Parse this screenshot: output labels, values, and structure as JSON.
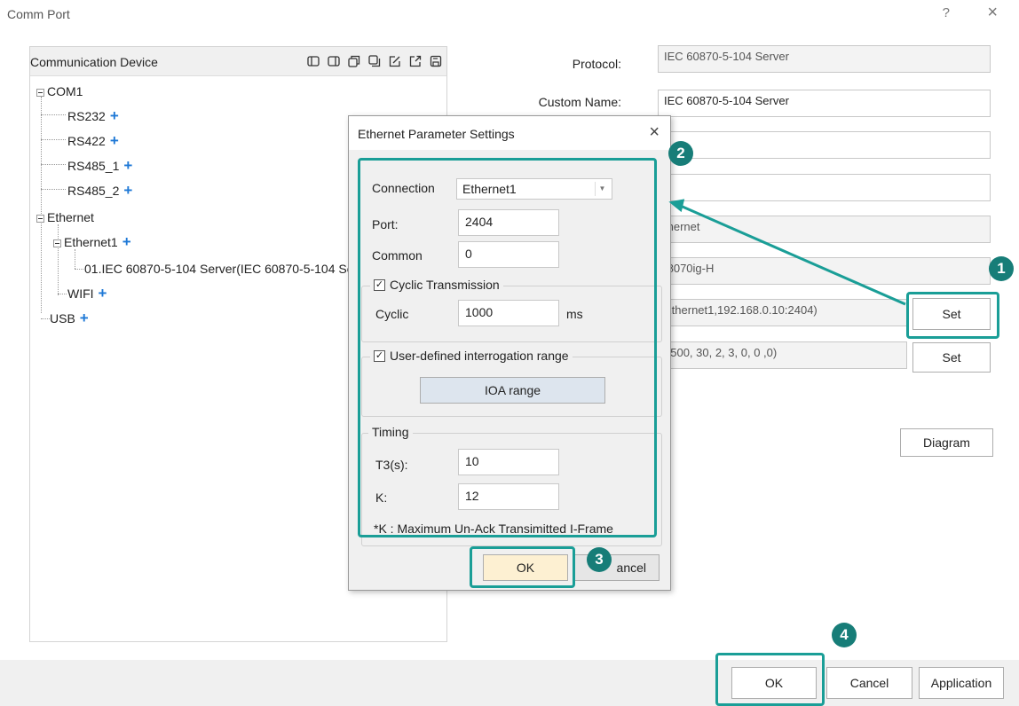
{
  "window": {
    "title": "Comm Port",
    "help": "?",
    "close": "×"
  },
  "left_panel": {
    "header": "Communication Device",
    "toolbar_icons": [
      "collapse-icon",
      "expand-icon",
      "copy-icon",
      "paste-icon",
      "edit-icon",
      "export-icon",
      "save-icon"
    ],
    "tree": {
      "com1": "COM1",
      "rs232": "RS232",
      "rs422": "RS422",
      "rs485_1": "RS485_1",
      "rs485_2": "RS485_2",
      "ethernet": "Ethernet",
      "ethernet1": "Ethernet1",
      "server": "01.IEC 60870-5-104 Server(IEC 60870-5-104 Se",
      "wifi": "WIFI",
      "usb": "USB",
      "add": "+"
    }
  },
  "form": {
    "protocol_label": "Protocol:",
    "protocol_value": "IEC 60870-5-104 Server",
    "custom_name_label": "Custom Name:",
    "custom_name_value": "IEC 60870-5-104 Server",
    "interface_value": "thernet",
    "device_value": "I8070ig-H",
    "conn_value": "Ethernet1,192.168.0.10:2404)",
    "timing_value": "1500, 30, 2, 3, 0, 0 ,0)",
    "set1": "Set",
    "set2": "Set",
    "diagram": "Diagram"
  },
  "bottom": {
    "ok": "OK",
    "cancel": "Cancel",
    "application": "Application"
  },
  "dialog": {
    "title": "Ethernet Parameter Settings",
    "close": "×",
    "connection_label": "Connection",
    "connection_value": "Ethernet1",
    "port_label": "Port:",
    "port_value": "2404",
    "common_label": "Common",
    "common_value": "0",
    "cyclic_group": "Cyclic Transmission",
    "cyclic_label": "Cyclic",
    "cyclic_value": "1000",
    "cyclic_unit": "ms",
    "udir_group": "User-defined interrogation range",
    "ioa_button": "IOA range",
    "timing_group": "Timing",
    "t3_label": "T3(s):",
    "t3_value": "10",
    "k_label": "K:",
    "k_value": "12",
    "note": "*K : Maximum Un-Ack Transimitted I-Frame",
    "ok": "OK",
    "cancel": "ancel",
    "check": "✓"
  },
  "badges": {
    "b1": "1",
    "b2": "2",
    "b3": "3",
    "b4": "4"
  },
  "colors": {
    "highlight": "#1a9e97",
    "badge": "#177d78",
    "tree_plus": "#1e78d6",
    "ok_button": "#fdf0d2"
  }
}
